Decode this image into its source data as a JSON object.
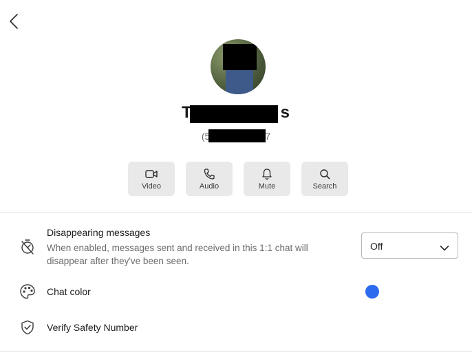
{
  "contact": {
    "name_prefix": "T",
    "name_suffix": "s",
    "phone_prefix": "(5",
    "phone_suffix": "7"
  },
  "actions": [
    {
      "label": "Video",
      "icon": "video-icon"
    },
    {
      "label": "Audio",
      "icon": "phone-icon"
    },
    {
      "label": "Mute",
      "icon": "bell-icon"
    },
    {
      "label": "Search",
      "icon": "search-icon"
    }
  ],
  "settings": {
    "disappearing": {
      "title": "Disappearing messages",
      "description": "When enabled, messages sent and received in this 1:1 chat will disappear after they've been seen.",
      "value": "Off"
    },
    "chat_color": {
      "title": "Chat color",
      "color": "#2c6bed"
    },
    "safety": {
      "title": "Verify Safety Number"
    }
  }
}
